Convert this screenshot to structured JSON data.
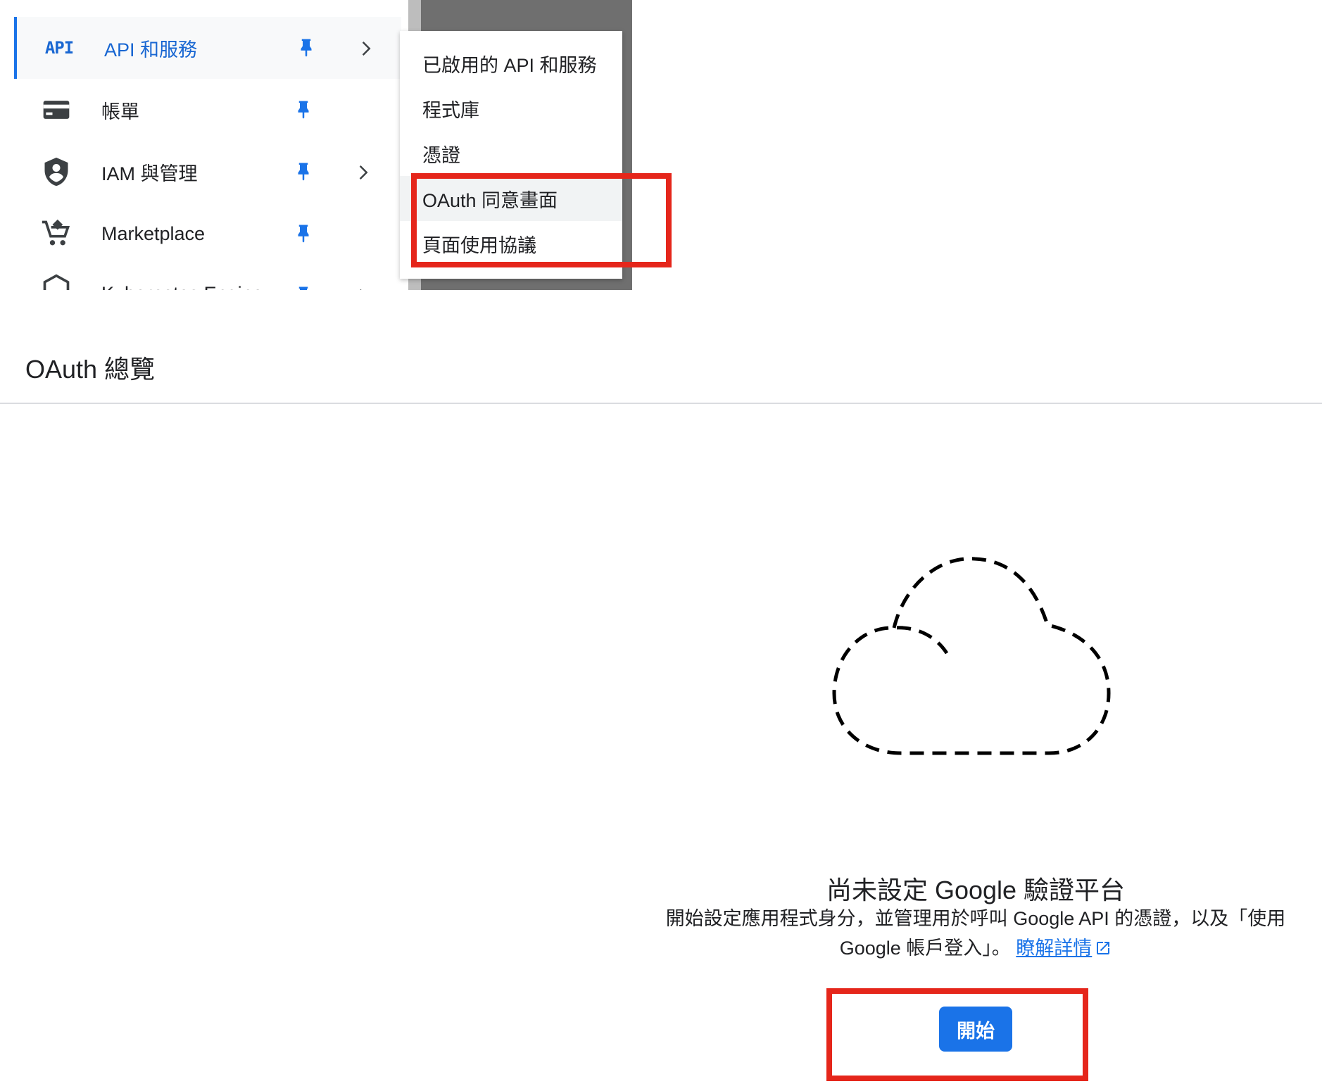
{
  "nav": {
    "items": [
      {
        "icon_text": "API",
        "label": "API 和服務",
        "active": true
      },
      {
        "label": "帳單"
      },
      {
        "label": "IAM 與管理"
      },
      {
        "label": "Marketplace"
      },
      {
        "label": "Kubernetes Engine"
      }
    ]
  },
  "submenu": {
    "items": [
      {
        "label": "已啟用的 API 和服務"
      },
      {
        "label": "程式庫"
      },
      {
        "label": "憑證"
      },
      {
        "label": "OAuth 同意畫面"
      },
      {
        "label": "頁面使用協議"
      }
    ]
  },
  "page": {
    "title": "OAuth 總覽"
  },
  "empty_state": {
    "title": "尚未設定 Google 驗證平台",
    "description": "開始設定應用程式身分，並管理用於呼叫 Google API 的憑證，以及「使用 Google 帳戶登入」。",
    "link_label": "瞭解詳情",
    "button_label": "開始"
  },
  "colors": {
    "accent": "#1a73e8",
    "highlight_box": "#e5261b"
  }
}
